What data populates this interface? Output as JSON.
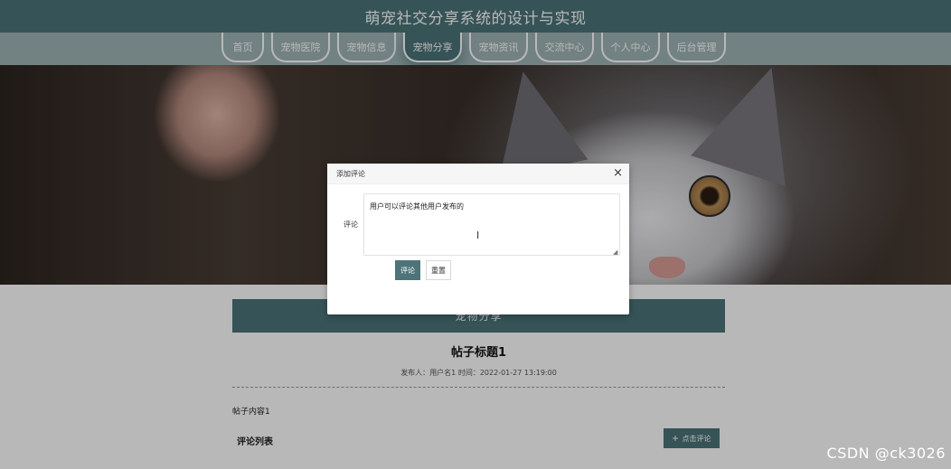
{
  "header": {
    "title": "萌宠社交分享系统的设计与实现"
  },
  "nav": {
    "items": [
      {
        "label": "首页"
      },
      {
        "label": "宠物医院"
      },
      {
        "label": "宠物信息"
      },
      {
        "label": "宠物分享"
      },
      {
        "label": "宠物资讯"
      },
      {
        "label": "交流中心"
      },
      {
        "label": "个人中心"
      },
      {
        "label": "后台管理"
      }
    ],
    "active_index": 3,
    "active_color": "#4c7479"
  },
  "content": {
    "section_title": "宠物分享",
    "post_title": "帖子标题1",
    "meta_author_label": "发布人：",
    "meta_author": "用户名1",
    "meta_time_label": "时间：",
    "meta_time": "2022-01-27 13:19:00",
    "post_body": "帖子内容1",
    "comments_heading": "评论列表",
    "comment_button_icon": "plus-icon",
    "comment_button_label": "点击评论"
  },
  "modal": {
    "title": "添加评论",
    "close_icon": "close-icon",
    "field_label": "评论",
    "textarea_value": "用户可以评论其他用户发布的",
    "submit_label": "评论",
    "reset_label": "重置"
  },
  "watermark": {
    "text": "CSDN @ck3026"
  },
  "colors": {
    "primary": "#4c7479",
    "nav_bg": "#9fb3b5"
  }
}
